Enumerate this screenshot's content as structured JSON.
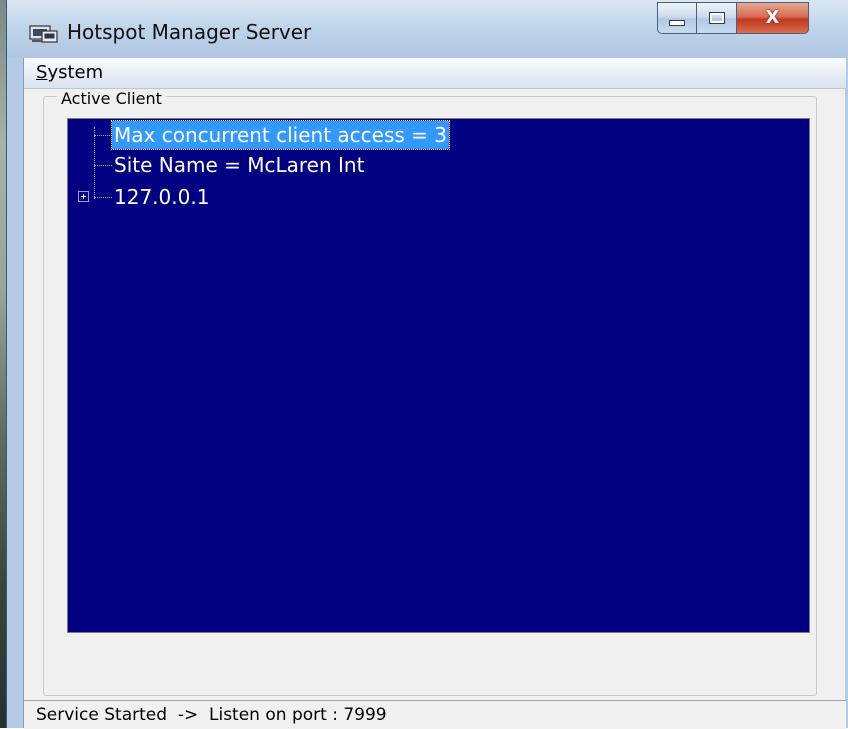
{
  "window": {
    "title": "Hotspot Manager Server",
    "icon": "server-app-icon",
    "controls": {
      "minimize": "minimize-icon",
      "maximize": "maximize-icon",
      "close_label": "X"
    }
  },
  "menu": {
    "items": [
      {
        "label": "System",
        "accelerator": "S"
      }
    ]
  },
  "group": {
    "label": "Active Client"
  },
  "tree": {
    "background": "#000080",
    "selection_color": "#3399ff",
    "nodes": [
      {
        "label": "Max concurrent client access = 3",
        "selected": true,
        "expandable": false
      },
      {
        "label": "Site Name = McLaren Int",
        "selected": false,
        "expandable": false
      },
      {
        "label": "127.0.0.1",
        "selected": false,
        "expandable": true
      }
    ]
  },
  "status": {
    "text": "Service Started  ->  Listen on port : 7999"
  }
}
